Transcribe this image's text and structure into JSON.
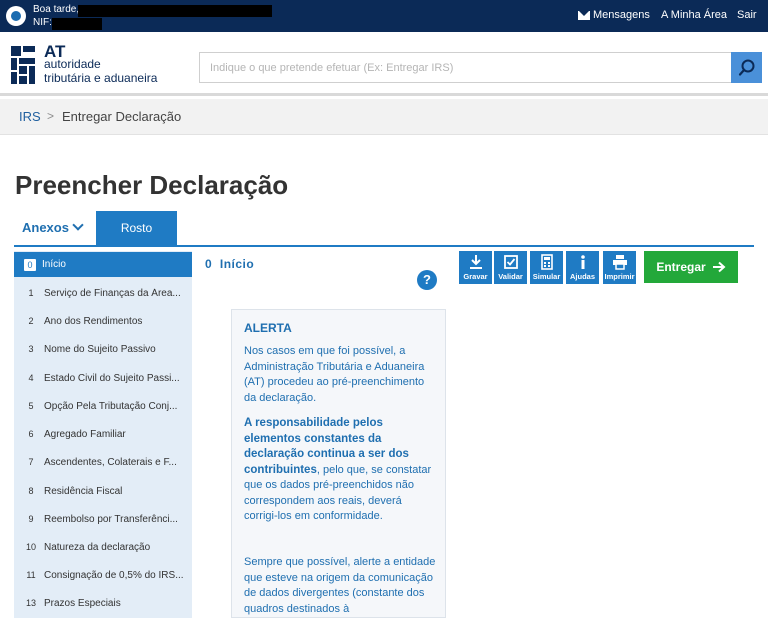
{
  "topbar": {
    "greeting": "Boa tarde,",
    "nif_label": "NIF:",
    "nav": {
      "messages": "Mensagens",
      "my_area": "A Minha Área",
      "logout": "Sair"
    }
  },
  "header": {
    "logo": {
      "title": "AT",
      "line1": "autoridade",
      "line2": "tributária e aduaneira"
    },
    "search": {
      "placeholder": "Indique o que pretende efetuar (Ex: Entregar IRS)",
      "value": ""
    }
  },
  "breadcrumb": {
    "root": "IRS",
    "separator": ">",
    "current": "Entregar Declaração"
  },
  "page": {
    "title": "Preencher Declaração"
  },
  "tabs": {
    "anexos": "Anexos",
    "rosto": "Rosto"
  },
  "sidebar": {
    "items": [
      {
        "num": "0",
        "label": "Início",
        "active": true
      },
      {
        "num": "1",
        "label": "Serviço de Finanças da Área..."
      },
      {
        "num": "2",
        "label": "Ano dos Rendimentos"
      },
      {
        "num": "3",
        "label": "Nome do Sujeito Passivo"
      },
      {
        "num": "4",
        "label": "Estado Civil do Sujeito Passi..."
      },
      {
        "num": "5",
        "label": "Opção Pela Tributação Conj..."
      },
      {
        "num": "6",
        "label": "Agregado Familiar"
      },
      {
        "num": "7",
        "label": "Ascendentes, Colaterais e F..."
      },
      {
        "num": "8",
        "label": "Residência Fiscal"
      },
      {
        "num": "9",
        "label": "Reembolso por Transferênci..."
      },
      {
        "num": "10",
        "label": "Natureza da declaração"
      },
      {
        "num": "11",
        "label": "Consignação de 0,5% do IRS..."
      },
      {
        "num": "13",
        "label": "Prazos Especiais"
      }
    ]
  },
  "main": {
    "heading_num": "0",
    "heading": "Início",
    "help": "?",
    "toolbar": {
      "save": "Gravar",
      "validate": "Validar",
      "simulate": "Simular",
      "help": "Ajudas",
      "print": "Imprimir"
    },
    "submit": "Entregar"
  },
  "alert": {
    "title": "ALERTA",
    "p1": "Nos casos em que foi possível, a Administração Tributária e Aduaneira (AT) procedeu ao pré-preenchimento da declaração.",
    "p2_bold": "A responsabilidade pelos elementos constantes da declaração continua a ser dos contribuintes",
    "p2_rest": ", pelo que, se constatar que os dados pré-preenchidos não correspondem aos reais, deverá corrigi-los em conformidade.",
    "p3": "Sempre que possível, alerte a entidade que esteve na origem da comunicação de dados divergentes (constante dos quadros destinados à"
  },
  "colors": {
    "navy": "#0b2a57",
    "primary": "#1f7bc4",
    "success": "#23a83a",
    "sidebar_bg": "#e3edf7"
  }
}
